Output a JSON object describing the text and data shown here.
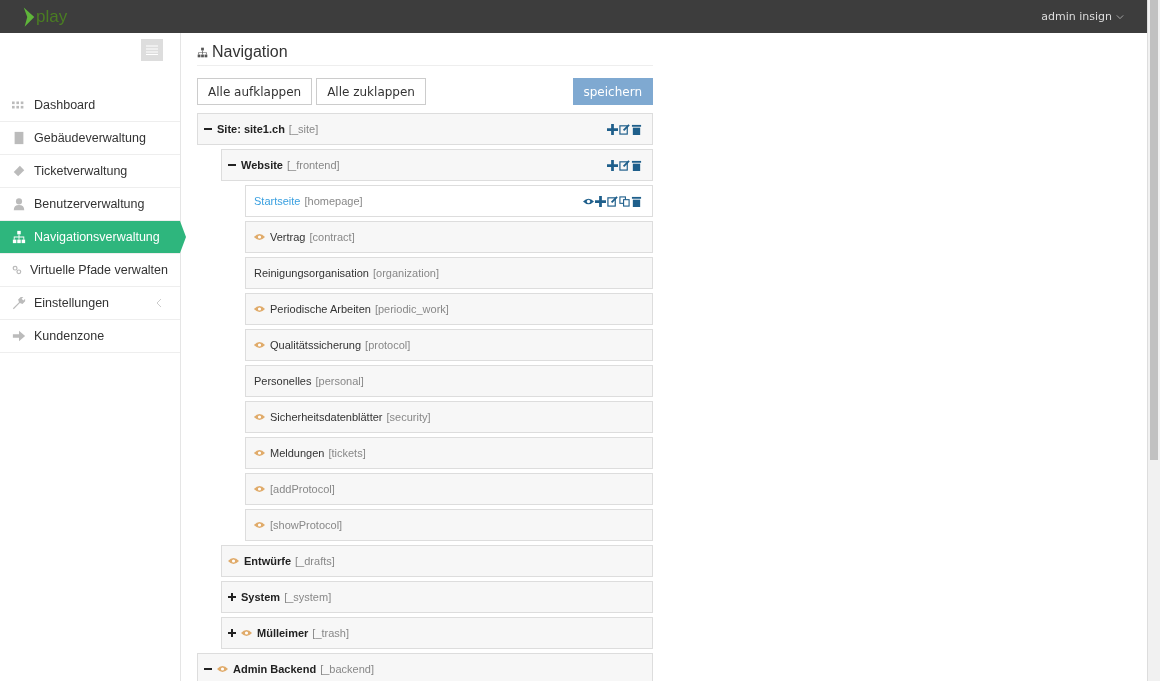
{
  "topbar": {
    "logo": "play",
    "user": "admin insign"
  },
  "sidebar": {
    "items": [
      {
        "label": "Dashboard",
        "selected": false,
        "submenu": false
      },
      {
        "label": "Gebäudeverwaltung",
        "selected": false,
        "submenu": false
      },
      {
        "label": "Ticketverwaltung",
        "selected": false,
        "submenu": false
      },
      {
        "label": "Benutzerverwaltung",
        "selected": false,
        "submenu": false
      },
      {
        "label": "Navigationsverwaltung",
        "selected": true,
        "submenu": false
      },
      {
        "label": "Virtuelle Pfade verwalten",
        "selected": false,
        "submenu": false
      },
      {
        "label": "Einstellungen",
        "selected": false,
        "submenu": true
      },
      {
        "label": "Kundenzone",
        "selected": false,
        "submenu": false
      }
    ]
  },
  "page": {
    "title": "Navigation",
    "buttons": [
      "Alle aufklappen",
      "Alle zuklappen"
    ],
    "save_button": "speichern"
  },
  "tree": [
    {
      "kind": "section",
      "label": "Site: site1.ch",
      "key": "[_site]",
      "expanded": true,
      "hidden": false,
      "actions": [
        {
          "kind": "add"
        },
        {
          "kind": "edit"
        },
        {
          "kind": "delete"
        }
      ],
      "children": [
        {
          "kind": "section",
          "label": "Website",
          "key": "[_frontend]",
          "expanded": true,
          "hidden": false,
          "actions": [
            {
              "kind": "add"
            },
            {
              "kind": "edit"
            },
            {
              "kind": "delete"
            }
          ],
          "children": [
            {
              "kind": "link",
              "label": "Startseite",
              "key": "[homepage]",
              "hidden": false,
              "actions": [
                {
                  "kind": "view"
                },
                {
                  "kind": "add"
                },
                {
                  "kind": "edit"
                },
                {
                  "kind": "copy"
                },
                {
                  "kind": "delete"
                }
              ]
            },
            {
              "kind": "page",
              "label": "Vertrag",
              "key": "[contract]",
              "hidden": true
            },
            {
              "kind": "page",
              "label": "Reinigungsorganisation",
              "key": "[organization]",
              "hidden": false
            },
            {
              "kind": "page",
              "label": "Periodische Arbeiten",
              "key": "[periodic_work]",
              "hidden": true
            },
            {
              "kind": "page",
              "label": "Qualitätssicherung",
              "key": "[protocol]",
              "hidden": true
            },
            {
              "kind": "page",
              "label": "Personelles",
              "key": "[personal]",
              "hidden": false
            },
            {
              "kind": "page",
              "label": "Sicherheitsdatenblätter",
              "key": "[security]",
              "hidden": true
            },
            {
              "kind": "page",
              "label": "Meldungen",
              "key": "[tickets]",
              "hidden": true
            },
            {
              "kind": "page",
              "key": "[addProtocol]",
              "hidden": true
            },
            {
              "kind": "page",
              "key": "[showProtocol]",
              "hidden": true
            }
          ]
        },
        {
          "kind": "section",
          "label": "Entwürfe",
          "key": "[_drafts]",
          "hidden": true
        },
        {
          "kind": "section",
          "label": "System",
          "key": "[_system]",
          "expanded": false,
          "hidden": false
        },
        {
          "kind": "section",
          "label": "Mülleimer",
          "key": "[_trash]",
          "expanded": false,
          "hidden": true
        }
      ]
    },
    {
      "kind": "section",
      "label": "Admin Backend",
      "key": "[_backend]",
      "expanded": true,
      "hidden": true
    }
  ]
}
